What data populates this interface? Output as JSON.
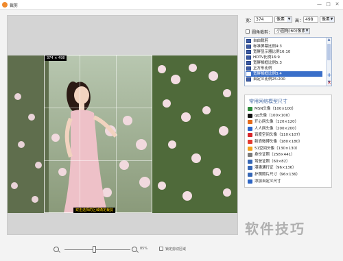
{
  "window": {
    "title": "裁剪",
    "minimize_glyph": "—",
    "maximize_glyph": "□",
    "close_glyph": "✕"
  },
  "canvas": {
    "size_tag": "374 × 498",
    "crop_hint": "双击选择的区域确定裁剪"
  },
  "size_panel": {
    "width_label": "宽：",
    "width_value": "374",
    "width_unit": "像素",
    "height_label": "高：",
    "height_value": "498",
    "height_unit": "像素",
    "round_crop_label": "圆角裁剪：",
    "round_crop_value": "小圆角(60)像素"
  },
  "ratio_list": {
    "items": [
      {
        "label": "自由裁剪",
        "selected": false
      },
      {
        "label": "标准屏幕比例4:3",
        "selected": false
      },
      {
        "label": "宽屏显示器比例16:10",
        "selected": false
      },
      {
        "label": "HDTV比例16:9",
        "selected": false
      },
      {
        "label": "宽屏相框比例5:3",
        "selected": false
      },
      {
        "label": "正方形比例",
        "selected": false
      },
      {
        "label": "宽屏相框比例3:4",
        "selected": true
      },
      {
        "label": "自定义比例25:200",
        "selected": false
      }
    ],
    "add_glyph": "+",
    "delete_glyph": "✕"
  },
  "common_sizes": {
    "title": "常用网络模型尺寸",
    "items": [
      {
        "label": "MSN头像（100×100）",
        "icon": "msn-icon",
        "color": "#2e8b3a"
      },
      {
        "label": "qq头像（100×100）",
        "icon": "qq-icon",
        "color": "#111111"
      },
      {
        "label": "开心网头像（120×120）",
        "icon": "kaixin-icon",
        "color": "#e46a1a"
      },
      {
        "label": "人人网头像（200×200）",
        "icon": "renren-icon",
        "color": "#2a64c8"
      },
      {
        "label": "百度空间头像（110×107）",
        "icon": "baidu-icon",
        "color": "#d8262b"
      },
      {
        "label": "新浪微博头像（180×180）",
        "icon": "weibo-icon",
        "color": "#e33a2f"
      },
      {
        "label": "51空间头像（130×130）",
        "icon": "51-icon",
        "color": "#f2a21c"
      },
      {
        "label": "身份证照（258×441）",
        "icon": "idcard-icon",
        "color": "#7a7a7a"
      },
      {
        "label": "驾驶证照（60×82）",
        "icon": "license-icon",
        "color": "#3566b5"
      },
      {
        "label": "港澳通行证（96×136）",
        "icon": "hkpass-icon",
        "color": "#3566b5"
      },
      {
        "label": "护照照片尺寸（96×136）",
        "icon": "passport-icon",
        "color": "#3566b5"
      },
      {
        "label": "添加自定义尺寸",
        "icon": "add-icon",
        "color": "#2c64c4"
      }
    ]
  },
  "zoom": {
    "value_label": "85%",
    "level": 0.45,
    "lock_label": "锁定剪切区域"
  },
  "watermark": "软件技巧"
}
